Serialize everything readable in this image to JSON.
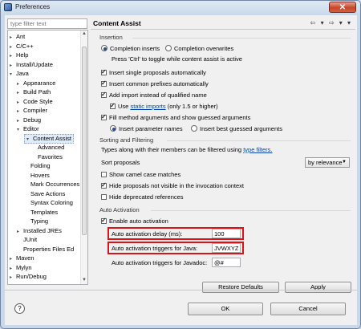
{
  "window": {
    "title": "Preferences",
    "close_glyph": "✕"
  },
  "sidebar": {
    "filter_placeholder": "type filter text",
    "items": [
      {
        "label": "Ant",
        "prefix": "▸"
      },
      {
        "label": "C/C++",
        "prefix": "▸"
      },
      {
        "label": "Help",
        "prefix": "▸"
      },
      {
        "label": "Install/Update",
        "prefix": "▸"
      },
      {
        "label": "Java",
        "prefix": "▾"
      },
      {
        "label": "Appearance",
        "prefix": "▸"
      },
      {
        "label": "Build Path",
        "prefix": "▸"
      },
      {
        "label": "Code Style",
        "prefix": "▸"
      },
      {
        "label": "Compiler",
        "prefix": "▸"
      },
      {
        "label": "Debug",
        "prefix": "▸"
      },
      {
        "label": "Editor",
        "prefix": "▾"
      },
      {
        "label": "Content Assist",
        "prefix": "▾"
      },
      {
        "label": "Advanced",
        "prefix": ""
      },
      {
        "label": "Favorites",
        "prefix": ""
      },
      {
        "label": "Folding",
        "prefix": ""
      },
      {
        "label": "Hovers",
        "prefix": ""
      },
      {
        "label": "Mark Occurrences",
        "prefix": ""
      },
      {
        "label": "Save Actions",
        "prefix": ""
      },
      {
        "label": "Syntax Coloring",
        "prefix": ""
      },
      {
        "label": "Templates",
        "prefix": ""
      },
      {
        "label": "Typing",
        "prefix": ""
      },
      {
        "label": "Installed JREs",
        "prefix": "▸"
      },
      {
        "label": "JUnit",
        "prefix": ""
      },
      {
        "label": "Properties Files Ed",
        "prefix": ""
      },
      {
        "label": "Maven",
        "prefix": "▸"
      },
      {
        "label": "Mylyn",
        "prefix": "▸"
      },
      {
        "label": "Run/Debug",
        "prefix": "▸"
      }
    ],
    "selected": "Content Assist"
  },
  "page": {
    "title": "Content Assist",
    "nav_arrows": "⇦ ▾ ⇨ ▾ ▾",
    "insertion": {
      "heading": "Insertion",
      "completion_inserts": "Completion inserts",
      "completion_overwrites": "Completion overwrites",
      "hint": "Press 'Ctrl' to toggle while content assist is active",
      "insert_single": "Insert single proposals automatically",
      "insert_common": "Insert common prefixes automatically",
      "add_import": "Add import instead of qualified name",
      "use_static_pre": "Use",
      "use_static_link": "static imports",
      "use_static_post": "(only 1.5 or higher)",
      "fill_method": "Fill method arguments and show guessed arguments",
      "insert_param_names": "Insert parameter names",
      "insert_best_guessed": "Insert best guessed arguments"
    },
    "sorting": {
      "heading": "Sorting and Filtering",
      "types_text": "Types along with their members can be filtered using",
      "type_filters_link": "type filters.",
      "sort_proposals": "Sort proposals",
      "sort_value": "by relevance",
      "show_camel": "Show camel case matches",
      "hide_invisible": "Hide proposals not visible in the invocation context",
      "hide_deprecated": "Hide deprecated references"
    },
    "activation": {
      "heading": "Auto Activation",
      "enable": "Enable auto activation",
      "delay_label": "Auto activation delay (ms):",
      "delay_value": "100",
      "java_triggers_label": "Auto activation triggers for Java:",
      "java_triggers_value": "JVWXYZ_",
      "javadoc_triggers_label": "Auto activation triggers for Javadoc:",
      "javadoc_triggers_value": "@#"
    },
    "restore_defaults": "Restore Defaults",
    "apply": "Apply"
  },
  "footer": {
    "help_glyph": "?",
    "ok": "OK",
    "cancel": "Cancel"
  }
}
